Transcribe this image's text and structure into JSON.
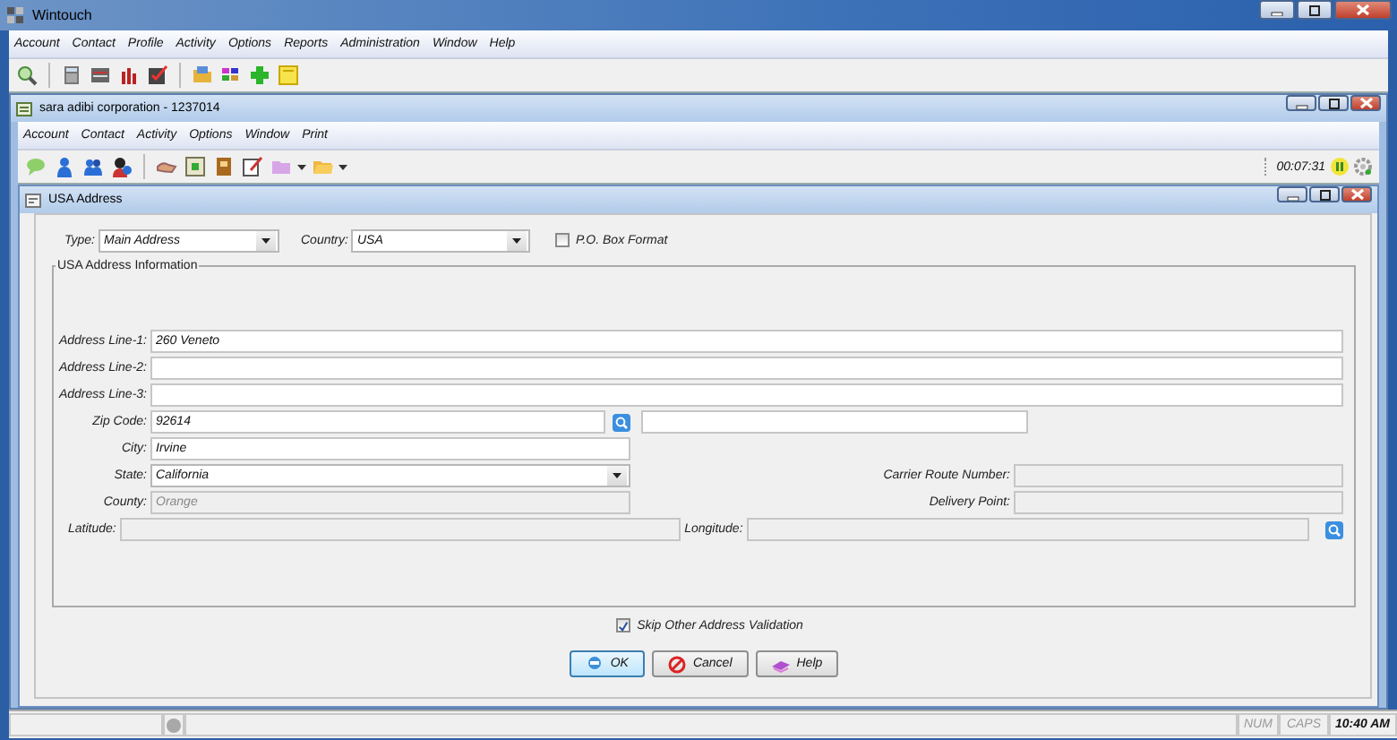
{
  "window": {
    "title": "Wintouch"
  },
  "menu": [
    "Account",
    "Contact",
    "Profile",
    "Activity",
    "Options",
    "Reports",
    "Administration",
    "Window",
    "Help"
  ],
  "child_window": {
    "title": "sara adibi corporation - 1237014",
    "menu": [
      "Account",
      "Contact",
      "Activity",
      "Options",
      "Window",
      "Print"
    ],
    "timer": "00:07:31"
  },
  "dialog": {
    "title": "USA Address",
    "type_field": {
      "label": "Type:",
      "value": "Main Address"
    },
    "country_field": {
      "label": "Country:",
      "value": "USA"
    },
    "po_box": {
      "label": "P.O. Box Format",
      "checked": false
    },
    "group_title": "USA Address Information",
    "address_lines": [
      {
        "label": "Address Line-1:",
        "value": "260 Veneto"
      },
      {
        "label": "Address Line-2:"
      },
      {
        "label": "Address Line-3:"
      }
    ],
    "zip": {
      "label": "Zip Code:",
      "value": "92614"
    },
    "city": {
      "label": "City:",
      "value": "Irvine"
    },
    "state": {
      "label": "State:",
      "value": "California"
    },
    "county": {
      "label": "County:",
      "value": "Orange",
      "disabled": true
    },
    "carrier_route": {
      "label": "Carrier Route Number:",
      "disabled": true
    },
    "delivery_point": {
      "label": "Delivery Point:",
      "disabled": true
    },
    "latitude": {
      "label": "Latitude:",
      "disabled": true
    },
    "longitude": {
      "label": "Longitude:",
      "disabled": true
    },
    "skip_validation": {
      "label": "Skip Other Address Validation",
      "checked": true
    },
    "buttons": [
      {
        "label": "OK",
        "kind": "ok",
        "default": true
      },
      {
        "label": "Cancel",
        "kind": "cancel",
        "default": false
      },
      {
        "label": "Help",
        "kind": "help",
        "default": false
      }
    ]
  },
  "status_bar": [
    {
      "text": "NUM",
      "active": false
    },
    {
      "text": "CAPS",
      "active": false
    },
    {
      "text": "10:40 AM",
      "active": true
    }
  ]
}
